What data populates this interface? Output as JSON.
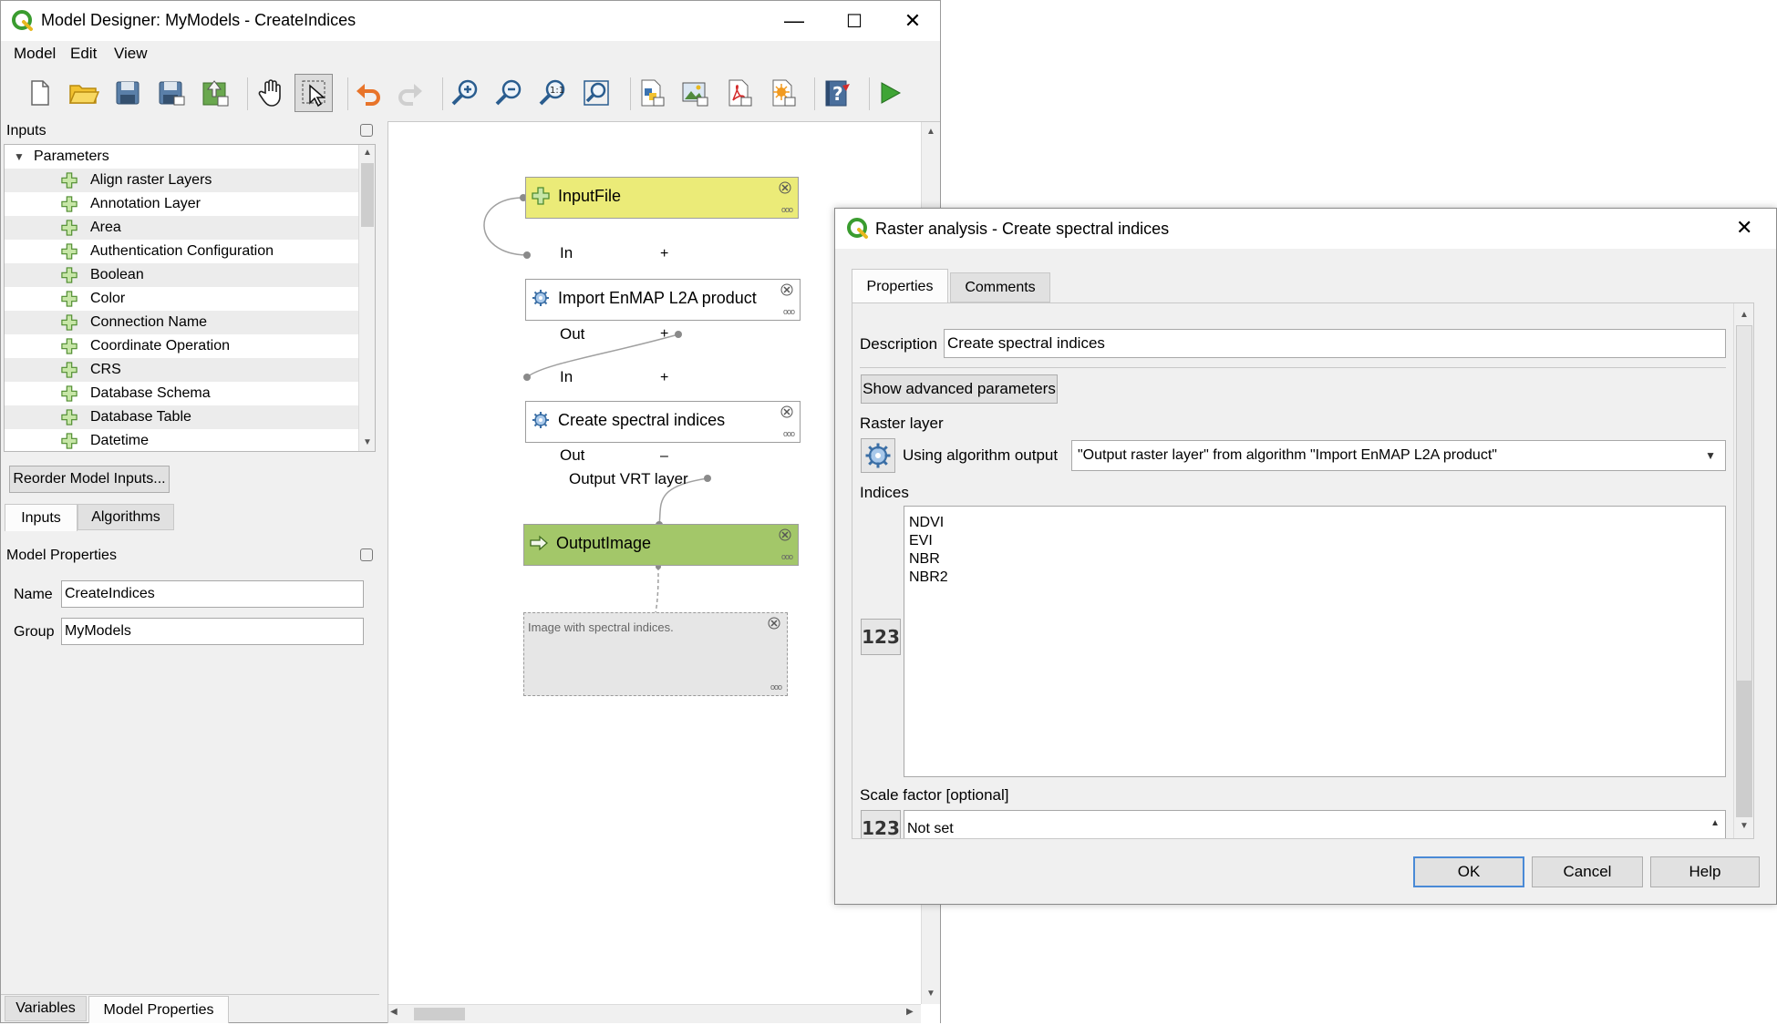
{
  "main_window": {
    "title": "Model Designer: MyModels - CreateIndices",
    "controls": {
      "minimize": "—",
      "maximize": "☐",
      "close": "✕"
    },
    "menu": [
      "Model",
      "Edit",
      "View"
    ],
    "toolbar_icons": [
      "new-model-icon",
      "open-model-icon",
      "save-model-icon",
      "save-as-icon",
      "save-to-project-icon",
      "pan-icon",
      "select-icon",
      "undo-icon",
      "redo-icon",
      "zoom-in-icon",
      "zoom-out-icon",
      "zoom-actual-icon",
      "zoom-full-icon",
      "export-python-icon",
      "export-image-icon",
      "export-pdf-icon",
      "export-svg-icon",
      "help-icon",
      "run-icon"
    ]
  },
  "inputs_panel": {
    "title": "Inputs",
    "group": "Parameters",
    "items": [
      "Align raster Layers",
      "Annotation Layer",
      "Area",
      "Authentication Configuration",
      "Boolean",
      "Color",
      "Connection Name",
      "Coordinate Operation",
      "CRS",
      "Database Schema",
      "Database Table",
      "Datetime"
    ],
    "reorder_button": "Reorder Model Inputs...",
    "tabs": [
      "Inputs",
      "Algorithms"
    ]
  },
  "model_properties": {
    "title": "Model Properties",
    "name_label": "Name",
    "name_value": "CreateIndices",
    "group_label": "Group",
    "group_value": "MyModels",
    "bottom_tabs": [
      "Variables",
      "Model Properties"
    ]
  },
  "canvas": {
    "nodes": {
      "input_file": "InputFile",
      "import": "Import EnMAP L2A product",
      "create": "Create spectral indices",
      "output": "OutputImage",
      "comment": "Image with spectral indices."
    },
    "ports": {
      "in1": "In",
      "plus1": "+",
      "out1": "Out",
      "plus2": "+",
      "in2": "In",
      "plus3": "+",
      "out2": "Out",
      "minus1": "–",
      "out_vrt": "Output VRT layer"
    },
    "colors": {
      "input": "#ebeb78",
      "algorithm": "#ffffff",
      "output": "#a3c769",
      "comment": "#e6e6e6"
    }
  },
  "dialog": {
    "title": "Raster analysis - Create spectral indices",
    "close": "✕",
    "tabs": [
      "Properties",
      "Comments"
    ],
    "description_label": "Description",
    "description_value": "Create spectral indices",
    "advanced_button": "Show advanced parameters",
    "raster_layer_label": "Raster layer",
    "using_label": "Using algorithm output",
    "raster_layer_value": "\"Output raster layer\" from algorithm \"Import EnMAP L2A product\"",
    "indices_label": "Indices",
    "indices_lines": [
      "NDVI",
      "EVI",
      "NBR",
      "NBR2"
    ],
    "num_icon": "123",
    "scale_label": "Scale factor [optional]",
    "scale_value": "Not set",
    "buttons": {
      "ok": "OK",
      "cancel": "Cancel",
      "help": "Help"
    }
  }
}
